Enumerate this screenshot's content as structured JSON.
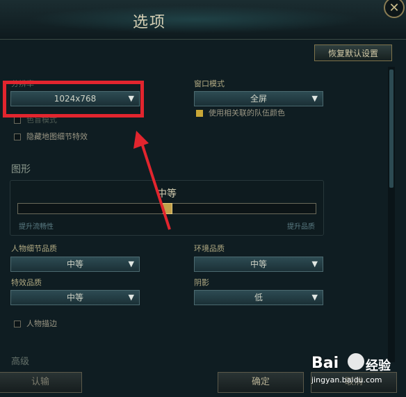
{
  "window": {
    "title": "选项",
    "close_glyph": "✕"
  },
  "toolbar": {
    "restore_defaults": "恢复默认设置"
  },
  "video": {
    "resolution_label": "分辨率",
    "resolution_value": "1024x768",
    "window_mode_label": "窗口模式",
    "window_mode_value": "全屏",
    "color_blind_label": "色盲模式",
    "hide_map_effects_label": "隐藏地图细节特效",
    "team_colors_label": "使用相关联的队伍颜色",
    "team_colors_checked": true
  },
  "graphics": {
    "section_title": "图形",
    "quality_value": "中等",
    "quality_level": 0.5,
    "left_label": "提升流畅性",
    "right_label": "提升品质",
    "character_quality_label": "人物细节品质",
    "character_quality_value": "中等",
    "environment_quality_label": "环境品质",
    "environment_quality_value": "中等",
    "effects_quality_label": "特效品质",
    "effects_quality_value": "中等",
    "shadows_label": "阴影",
    "shadows_value": "低",
    "character_outline_label": "人物描边"
  },
  "next_section": {
    "title": "高级"
  },
  "footer": {
    "confirm_left": "认输",
    "ok": "确定",
    "cancel": "取消"
  },
  "watermark": {
    "brand": "Bai",
    "brand_cn": "经验",
    "url": "jingyan.baidu.com"
  },
  "colors": {
    "annotation_red": "#e2252e",
    "accent_gold": "#c9a737",
    "dropdown_teal": "#2d4b53"
  }
}
